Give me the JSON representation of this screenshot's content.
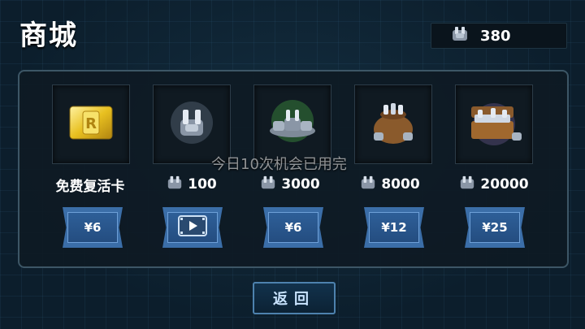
{
  "header": {
    "title": "商城"
  },
  "currency": {
    "icon": "crystal-coin-icon",
    "amount": "380"
  },
  "items": [
    {
      "name": "免费复活卡",
      "icon": "gold-revive-card-icon",
      "price_label": "¥6"
    },
    {
      "amount": "100",
      "icon": "single-crystal-icon",
      "price_label": "",
      "button_icon": "video-play-icon"
    },
    {
      "amount": "3000",
      "icon": "crystal-pile-icon",
      "price_label": "¥6"
    },
    {
      "amount": "8000",
      "icon": "crystal-bag-icon",
      "price_label": "¥12"
    },
    {
      "amount": "20000",
      "icon": "treasure-chest-icon",
      "price_label": "¥25"
    }
  ],
  "notice": "今日10次机会已用完",
  "back_button": {
    "label": "返回"
  },
  "colors": {
    "button_blue": "#3b6ea8",
    "panel_border": "#3c5666",
    "gold": "#e8c020"
  }
}
